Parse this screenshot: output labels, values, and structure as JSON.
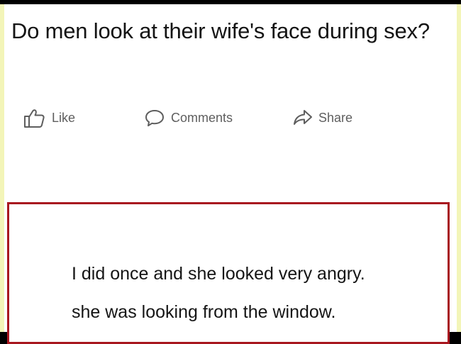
{
  "post": {
    "question": "Do men look at their wife's face during sex?"
  },
  "actions": {
    "like": {
      "label": "Like",
      "icon": "thumbs-up-icon"
    },
    "comments": {
      "label": "Comments",
      "icon": "speech-bubble-icon"
    },
    "share": {
      "label": "Share",
      "icon": "share-arrow-icon"
    }
  },
  "reply": {
    "line1": "I did once and she looked very angry.",
    "line2": "she was looking from the window."
  },
  "colors": {
    "frame": "#f3f5b8",
    "reply_border": "#a8171f",
    "action_text": "#5e5e5e"
  }
}
